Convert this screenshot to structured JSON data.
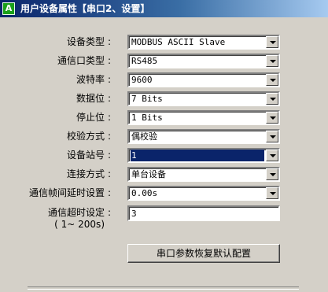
{
  "window": {
    "title": "用户设备属性【串口2、设置】",
    "icon": "A"
  },
  "colon": ":",
  "fields": [
    {
      "label": "设备类型",
      "value": "MODBUS ASCII Slave"
    },
    {
      "label": "通信口类型",
      "value": "RS485"
    },
    {
      "label": "波特率",
      "value": "9600"
    },
    {
      "label": "数据位",
      "value": "7 Bits"
    },
    {
      "label": "停止位",
      "value": "1 Bits"
    },
    {
      "label": "校验方式",
      "value": "偶校验"
    },
    {
      "label": "设备站号",
      "value": "1"
    },
    {
      "label": "连接方式",
      "value": "单台设备"
    },
    {
      "label": "通信帧间延时设置",
      "value": "0.00s"
    }
  ],
  "timeout": {
    "label": "通信超时设定",
    "range": "( 1~ 200s)",
    "value": "3"
  },
  "restore_button": "串口参数恢复默认配置"
}
